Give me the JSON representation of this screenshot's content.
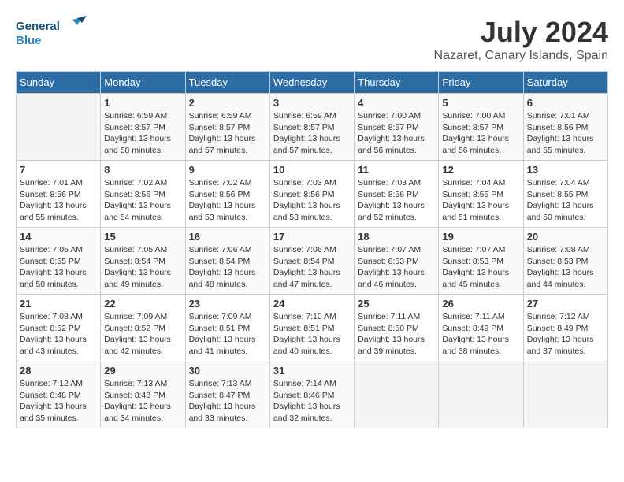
{
  "logo": {
    "line1": "General",
    "line2": "Blue"
  },
  "title": "July 2024",
  "location": "Nazaret, Canary Islands, Spain",
  "days_of_week": [
    "Sunday",
    "Monday",
    "Tuesday",
    "Wednesday",
    "Thursday",
    "Friday",
    "Saturday"
  ],
  "weeks": [
    [
      {
        "day": "",
        "info": ""
      },
      {
        "day": "1",
        "info": "Sunrise: 6:59 AM\nSunset: 8:57 PM\nDaylight: 13 hours\nand 58 minutes."
      },
      {
        "day": "2",
        "info": "Sunrise: 6:59 AM\nSunset: 8:57 PM\nDaylight: 13 hours\nand 57 minutes."
      },
      {
        "day": "3",
        "info": "Sunrise: 6:59 AM\nSunset: 8:57 PM\nDaylight: 13 hours\nand 57 minutes."
      },
      {
        "day": "4",
        "info": "Sunrise: 7:00 AM\nSunset: 8:57 PM\nDaylight: 13 hours\nand 56 minutes."
      },
      {
        "day": "5",
        "info": "Sunrise: 7:00 AM\nSunset: 8:57 PM\nDaylight: 13 hours\nand 56 minutes."
      },
      {
        "day": "6",
        "info": "Sunrise: 7:01 AM\nSunset: 8:56 PM\nDaylight: 13 hours\nand 55 minutes."
      }
    ],
    [
      {
        "day": "7",
        "info": "Sunrise: 7:01 AM\nSunset: 8:56 PM\nDaylight: 13 hours\nand 55 minutes."
      },
      {
        "day": "8",
        "info": "Sunrise: 7:02 AM\nSunset: 8:56 PM\nDaylight: 13 hours\nand 54 minutes."
      },
      {
        "day": "9",
        "info": "Sunrise: 7:02 AM\nSunset: 8:56 PM\nDaylight: 13 hours\nand 53 minutes."
      },
      {
        "day": "10",
        "info": "Sunrise: 7:03 AM\nSunset: 8:56 PM\nDaylight: 13 hours\nand 53 minutes."
      },
      {
        "day": "11",
        "info": "Sunrise: 7:03 AM\nSunset: 8:56 PM\nDaylight: 13 hours\nand 52 minutes."
      },
      {
        "day": "12",
        "info": "Sunrise: 7:04 AM\nSunset: 8:55 PM\nDaylight: 13 hours\nand 51 minutes."
      },
      {
        "day": "13",
        "info": "Sunrise: 7:04 AM\nSunset: 8:55 PM\nDaylight: 13 hours\nand 50 minutes."
      }
    ],
    [
      {
        "day": "14",
        "info": "Sunrise: 7:05 AM\nSunset: 8:55 PM\nDaylight: 13 hours\nand 50 minutes."
      },
      {
        "day": "15",
        "info": "Sunrise: 7:05 AM\nSunset: 8:54 PM\nDaylight: 13 hours\nand 49 minutes."
      },
      {
        "day": "16",
        "info": "Sunrise: 7:06 AM\nSunset: 8:54 PM\nDaylight: 13 hours\nand 48 minutes."
      },
      {
        "day": "17",
        "info": "Sunrise: 7:06 AM\nSunset: 8:54 PM\nDaylight: 13 hours\nand 47 minutes."
      },
      {
        "day": "18",
        "info": "Sunrise: 7:07 AM\nSunset: 8:53 PM\nDaylight: 13 hours\nand 46 minutes."
      },
      {
        "day": "19",
        "info": "Sunrise: 7:07 AM\nSunset: 8:53 PM\nDaylight: 13 hours\nand 45 minutes."
      },
      {
        "day": "20",
        "info": "Sunrise: 7:08 AM\nSunset: 8:53 PM\nDaylight: 13 hours\nand 44 minutes."
      }
    ],
    [
      {
        "day": "21",
        "info": "Sunrise: 7:08 AM\nSunset: 8:52 PM\nDaylight: 13 hours\nand 43 minutes."
      },
      {
        "day": "22",
        "info": "Sunrise: 7:09 AM\nSunset: 8:52 PM\nDaylight: 13 hours\nand 42 minutes."
      },
      {
        "day": "23",
        "info": "Sunrise: 7:09 AM\nSunset: 8:51 PM\nDaylight: 13 hours\nand 41 minutes."
      },
      {
        "day": "24",
        "info": "Sunrise: 7:10 AM\nSunset: 8:51 PM\nDaylight: 13 hours\nand 40 minutes."
      },
      {
        "day": "25",
        "info": "Sunrise: 7:11 AM\nSunset: 8:50 PM\nDaylight: 13 hours\nand 39 minutes."
      },
      {
        "day": "26",
        "info": "Sunrise: 7:11 AM\nSunset: 8:49 PM\nDaylight: 13 hours\nand 38 minutes."
      },
      {
        "day": "27",
        "info": "Sunrise: 7:12 AM\nSunset: 8:49 PM\nDaylight: 13 hours\nand 37 minutes."
      }
    ],
    [
      {
        "day": "28",
        "info": "Sunrise: 7:12 AM\nSunset: 8:48 PM\nDaylight: 13 hours\nand 35 minutes."
      },
      {
        "day": "29",
        "info": "Sunrise: 7:13 AM\nSunset: 8:48 PM\nDaylight: 13 hours\nand 34 minutes."
      },
      {
        "day": "30",
        "info": "Sunrise: 7:13 AM\nSunset: 8:47 PM\nDaylight: 13 hours\nand 33 minutes."
      },
      {
        "day": "31",
        "info": "Sunrise: 7:14 AM\nSunset: 8:46 PM\nDaylight: 13 hours\nand 32 minutes."
      },
      {
        "day": "",
        "info": ""
      },
      {
        "day": "",
        "info": ""
      },
      {
        "day": "",
        "info": ""
      }
    ]
  ]
}
